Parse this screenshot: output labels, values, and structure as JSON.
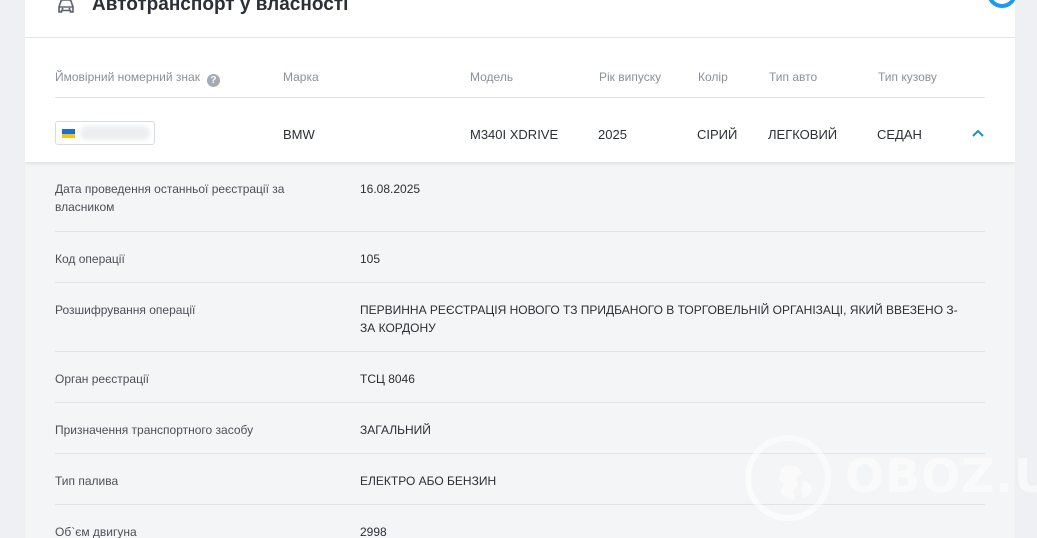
{
  "section": {
    "title": "Автотранспорт у власності",
    "icon": "car-icon"
  },
  "table": {
    "columns": [
      "Ймовірний номерний знак",
      "Марка",
      "Модель",
      "Рік випуску",
      "Колір",
      "Тип авто",
      "Тип кузову"
    ],
    "row": {
      "brand": "BMW",
      "model": "M340I XDRIVE",
      "year": "2025",
      "color": "СІРИЙ",
      "vehicle_type": "ЛЕГКОВИЙ",
      "body_type": "СЕДАН"
    }
  },
  "details": [
    {
      "label": "Дата проведення останньої реєстрації за власником",
      "value": "16.08.2025"
    },
    {
      "label": "Код операції",
      "value": "105"
    },
    {
      "label": "Розшифрування операції",
      "value": "ПЕРВИННА РЕЄСТРАЦІЯ НОВОГО ТЗ ПРИДБАНОГО В ТОРГОВЕЛЬНІЙ ОРГАНІЗАЦІ, ЯКИЙ ВВЕЗЕНО З-ЗА КОРДОНУ"
    },
    {
      "label": "Орган реєстрації",
      "value": "ТСЦ 8046"
    },
    {
      "label": "Призначення транспортного засобу",
      "value": "ЗАГАЛЬНИЙ"
    },
    {
      "label": "Тип палива",
      "value": "ЕЛЕКТРО АБО БЕНЗИН"
    },
    {
      "label": "Об`єм двигуна",
      "value": "2998"
    }
  ],
  "watermark": {
    "text": "OBOZ.UA"
  },
  "colors": {
    "accent": "#1e9be6",
    "chevron": "#1a8fc9",
    "flag_blue": "#1f6fd1",
    "flag_yellow": "#f3c614"
  }
}
